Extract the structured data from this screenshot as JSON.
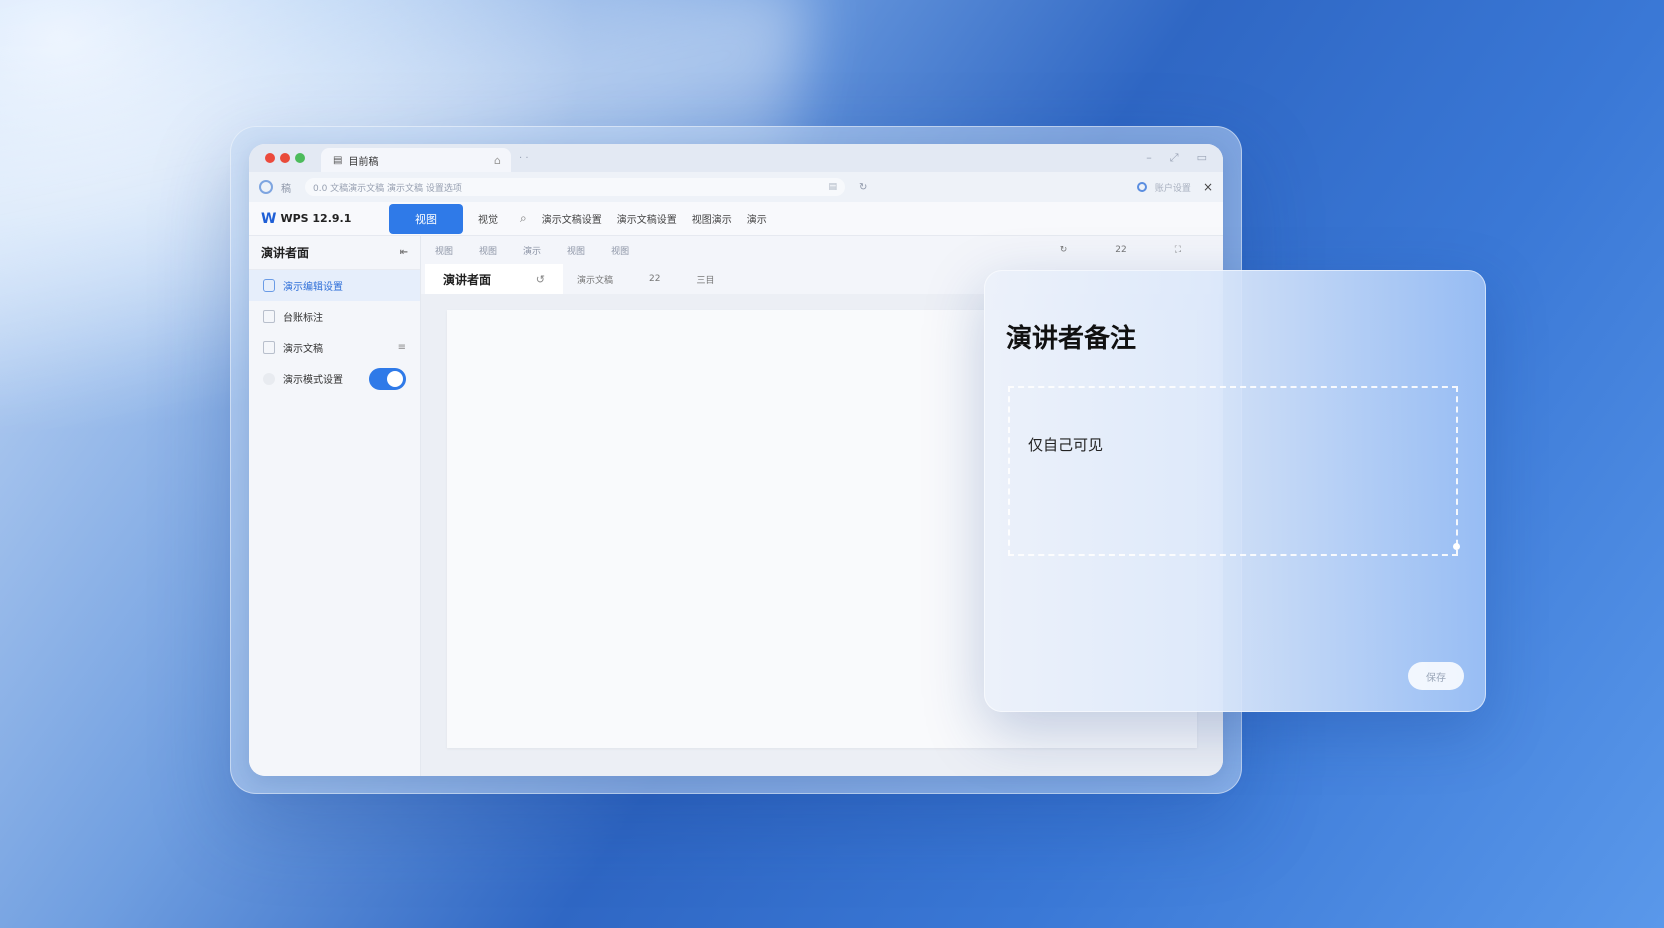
{
  "window": {
    "tab_title": "目前稿",
    "tab_add": "· ·",
    "controls": [
      "–",
      "⤢",
      "▭"
    ]
  },
  "addressbar": {
    "brand": "稿",
    "url": "0.0 文稿演示文稿 演示文稿 设置选项",
    "account": "账户设置",
    "close": "×"
  },
  "toolbar": {
    "brand_logo": "W",
    "brand": "WPS 12.9.1",
    "view_button": "视图",
    "menu": [
      "视觉",
      "演示文稿设置",
      "演示文稿设置",
      "视图演示",
      "演示"
    ]
  },
  "ribbon": {
    "items": [
      "视图",
      "视图",
      "演示",
      "视图",
      "视图"
    ],
    "right": [
      "↻",
      "22",
      "⛶"
    ]
  },
  "doc_tabs": {
    "active": "演讲者面",
    "refresh": "↺",
    "others": [
      "演示文稿",
      "22",
      "三目"
    ]
  },
  "sidebar": {
    "header": "演讲者面",
    "items": [
      {
        "label": "演示编辑设置"
      },
      {
        "label": "台账标注"
      },
      {
        "label": "演示文稿"
      },
      {
        "label": "演示模式设置"
      }
    ],
    "toggle_on": true
  },
  "notes": {
    "title": "演讲者备注",
    "text": "仅自己可见",
    "button": "保存"
  }
}
